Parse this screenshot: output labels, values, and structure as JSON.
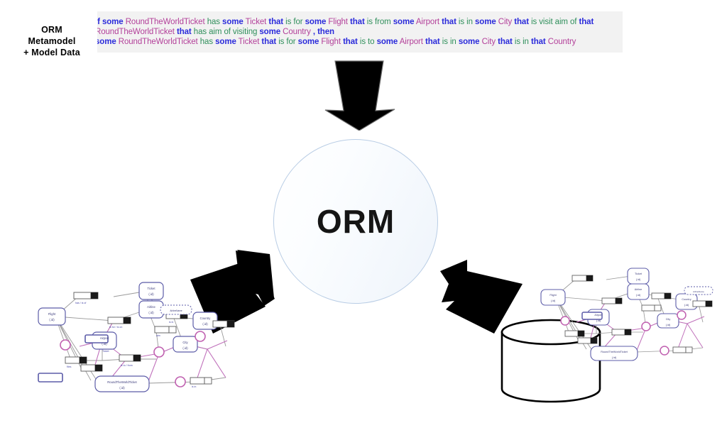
{
  "page": {
    "title": "ORM",
    "background_color": "#ffffff"
  },
  "verbalization": {
    "name": "orm-verbalization-text",
    "background_color": "#f2f2f2",
    "colors": {
      "keyword": "#2b2bdb",
      "object_type": "#b3409a",
      "predicate": "#2f8f5b",
      "plain": "#3a3a9a"
    },
    "lines": [
      {
        "tokens": [
          {
            "t": "If",
            "c": "kw"
          },
          {
            "t": "some",
            "c": "kw"
          },
          {
            "t": "RoundTheWorldTicket",
            "c": "obj"
          },
          {
            "t": "has",
            "c": "pred"
          },
          {
            "t": "some",
            "c": "kw"
          },
          {
            "t": "Ticket",
            "c": "obj"
          },
          {
            "t": "that",
            "c": "kw"
          },
          {
            "t": "is for",
            "c": "pred"
          },
          {
            "t": "some",
            "c": "kw"
          },
          {
            "t": "Flight",
            "c": "obj"
          },
          {
            "t": "that",
            "c": "kw"
          },
          {
            "t": "is from",
            "c": "pred"
          },
          {
            "t": "some",
            "c": "kw"
          },
          {
            "t": "Airport",
            "c": "obj"
          },
          {
            "t": "that",
            "c": "kw"
          },
          {
            "t": "is in",
            "c": "pred"
          },
          {
            "t": "some",
            "c": "kw"
          },
          {
            "t": "City",
            "c": "obj"
          },
          {
            "t": "that",
            "c": "kw"
          },
          {
            "t": "is visit aim of",
            "c": "pred"
          },
          {
            "t": "that",
            "c": "kw"
          }
        ]
      },
      {
        "tokens": [
          {
            "t": "RoundTheWorldTicket",
            "c": "obj"
          },
          {
            "t": "that",
            "c": "kw"
          },
          {
            "t": "has aim of visiting",
            "c": "pred"
          },
          {
            "t": "some",
            "c": "kw"
          },
          {
            "t": "Country",
            "c": "obj"
          },
          {
            "t": ",",
            "c": "punc"
          },
          {
            "t": "then",
            "c": "kw"
          }
        ]
      },
      {
        "tokens": [
          {
            "t": "some",
            "c": "kw"
          },
          {
            "t": "RoundTheWorldTicket",
            "c": "obj"
          },
          {
            "t": "has",
            "c": "pred"
          },
          {
            "t": "some",
            "c": "kw"
          },
          {
            "t": "Ticket",
            "c": "obj"
          },
          {
            "t": "that",
            "c": "kw"
          },
          {
            "t": "is for",
            "c": "pred"
          },
          {
            "t": "some",
            "c": "kw"
          },
          {
            "t": "Flight",
            "c": "obj"
          },
          {
            "t": "that",
            "c": "kw"
          },
          {
            "t": "is to",
            "c": "pred"
          },
          {
            "t": "some",
            "c": "kw"
          },
          {
            "t": "Airport",
            "c": "obj"
          },
          {
            "t": "that",
            "c": "kw"
          },
          {
            "t": "is in",
            "c": "pred"
          },
          {
            "t": "some",
            "c": "kw"
          },
          {
            "t": "City",
            "c": "obj"
          },
          {
            "t": "that",
            "c": "kw"
          },
          {
            "t": "is in",
            "c": "pred"
          },
          {
            "t": "that",
            "c": "kw"
          },
          {
            "t": "Country",
            "c": "obj"
          }
        ]
      }
    ]
  },
  "center": {
    "label": "ORM",
    "border_color": "#b9cde5",
    "fill_from": "#ffffff",
    "fill_to": "#eef4fb"
  },
  "arrows": [
    {
      "name": "arrow-down-from-verbalization",
      "direction": "down",
      "color": "#000000"
    },
    {
      "name": "arrow-up-right-from-schema",
      "direction": "up-right",
      "color": "#000000"
    },
    {
      "name": "arrow-up-left-from-database",
      "direction": "up-left",
      "color": "#000000"
    }
  ],
  "database": {
    "name": "orm-metamodel-database",
    "label_lines": [
      "ORM",
      "Metamodel",
      "+ Model Data"
    ],
    "stroke": "#000000",
    "fill": "#ffffff"
  },
  "schema_left": {
    "name": "orm-schema-diagram-left",
    "entity_types": [
      "Flight",
      "Ticket",
      "Airline",
      "Airport",
      "City",
      "Country",
      "RoundTheWorldTicket",
      "Aircraft"
    ],
    "value_type": "AirlineName",
    "colors": {
      "entity_border": "#5c5ca8",
      "role_box_border": "#5a5a5a",
      "link": "#8a8a8a",
      "constraint": "#c060b0",
      "reading": "#3a3a9a"
    }
  },
  "schema_right": {
    "name": "orm-schema-diagram-right",
    "entity_types": [
      "Flight",
      "Ticket",
      "Airline",
      "Airport",
      "City",
      "Country",
      "RoundTheWorldTicket"
    ],
    "colors": {
      "entity_border": "#5c5ca8",
      "role_box_border": "#5a5a5a",
      "link": "#8a8a8a",
      "constraint": "#c060b0",
      "reading": "#3a3a9a"
    }
  }
}
